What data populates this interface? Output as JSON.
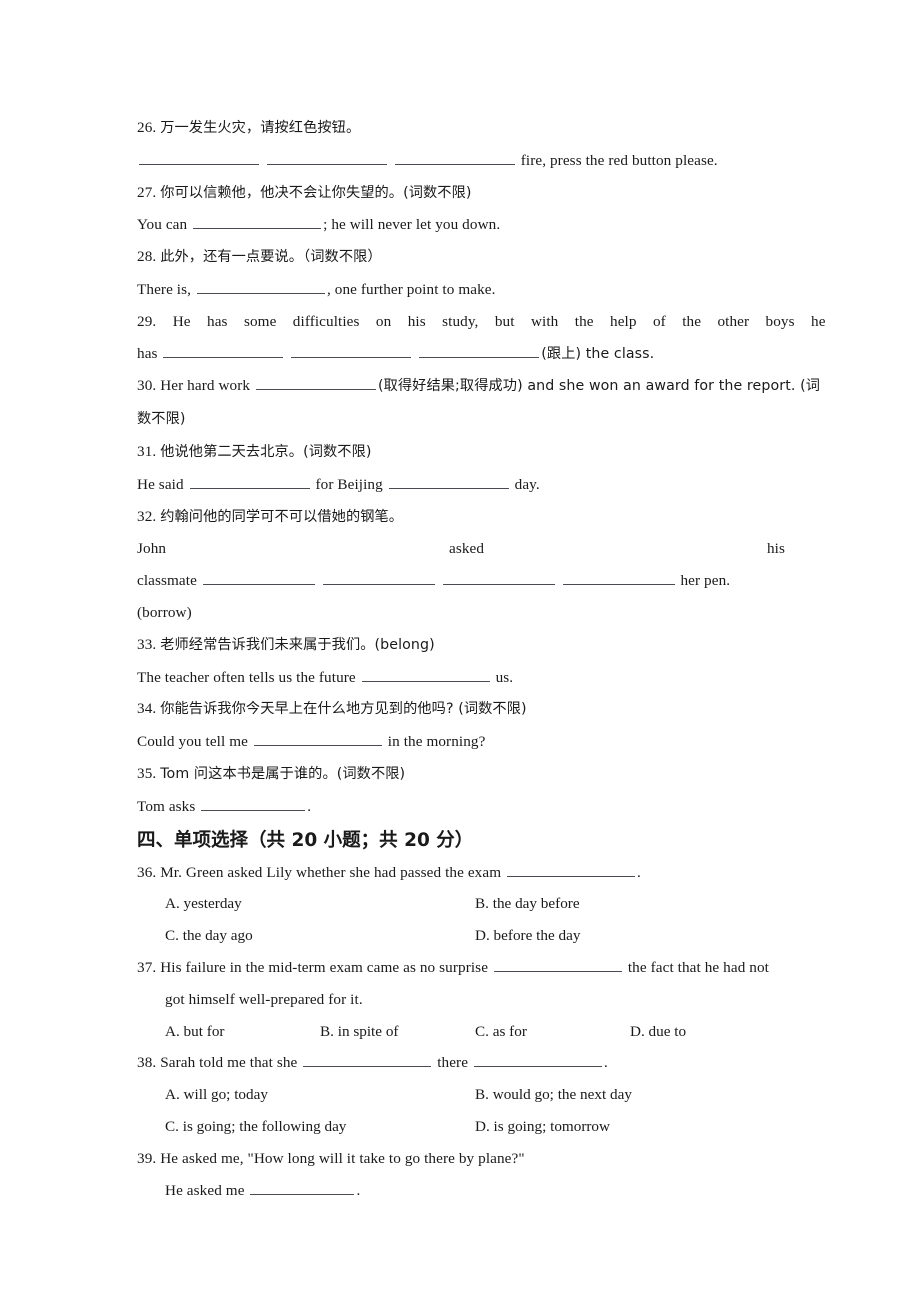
{
  "document": {
    "type": "english-grammar-worksheet",
    "language_mix": "chinese-english"
  },
  "fill_in_blank_items": [
    {
      "number": "26.",
      "prompt_cn": "万一发生火灾，请按红色按钮。",
      "answer_line_tail": "fire, press the red button please.",
      "blanks": 3
    },
    {
      "number": "27.",
      "prompt_cn": "你可以信赖他，他决不会让你失望的。(词数不限)",
      "answer_prefix": "You can",
      "answer_suffix": "; he will never let you down.",
      "blanks": 1
    },
    {
      "number": "28.",
      "prompt_cn": "此外，还有一点要说。（词数不限）",
      "answer_prefix": "There is,",
      "answer_suffix": ", one further point to make.",
      "blanks": 1
    },
    {
      "number": "29.",
      "prompt_en_line1": "He has some difficulties on his study, but with the help of the other boys he",
      "answer_prefix": "has",
      "answer_suffix": "(跟上) the class.",
      "blanks": 3
    },
    {
      "number": "30.",
      "answer_prefix": "Her hard work",
      "answer_suffix": "(取得好结果;取得成功) and she won an award for the report. (词",
      "answer_wrap": "数不限)",
      "blanks": 1
    },
    {
      "number": "31.",
      "prompt_cn": "他说他第二天去北京。(词数不限)",
      "answer_prefix": "He said",
      "answer_mid": "for Beijing",
      "answer_suffix": "day.",
      "blanks": 2
    },
    {
      "number": "32.",
      "prompt_cn": "约翰问他的同学可不可以借她的钢笔。",
      "justified_words": [
        "John",
        "asked",
        "his"
      ],
      "answer_prefix": "classmate",
      "answer_suffix": "her pen.",
      "hint": "(borrow)",
      "blanks": 4
    },
    {
      "number": "33.",
      "prompt_cn": "老师经常告诉我们未来属于我们。(belong)",
      "answer_prefix": "The teacher often tells us the future",
      "answer_suffix": "us.",
      "blanks": 1
    },
    {
      "number": "34.",
      "prompt_cn": "你能告诉我你今天早上在什么地方见到的他吗? (词数不限)",
      "answer_prefix": "Could you tell me",
      "answer_suffix": "in the morning?",
      "blanks": 1
    },
    {
      "number": "35.",
      "prompt_cn": "Tom 问这本书是属于谁的。(词数不限)",
      "answer_prefix": "Tom asks",
      "answer_suffix": ".",
      "blanks": 1
    }
  ],
  "section_heading": {
    "prefix_cn": "四、单项选择（共",
    "count": "20",
    "mid_cn": "小题；共",
    "points": "20",
    "suffix_cn": "分）",
    "full": "四、单项选择（共 20 小题；共 20 分）"
  },
  "multiple_choice_items": [
    {
      "number": "36.",
      "stem_before": "Mr. Green asked Lily whether she had passed the exam",
      "stem_after": ".",
      "layout": "two-column",
      "options": [
        "A. yesterday",
        "B. the day before",
        "C. the day ago",
        "D. before the day"
      ]
    },
    {
      "number": "37.",
      "stem_before": "His failure in the mid-term exam came as no surprise",
      "stem_after": "the fact that he had not",
      "stem_wrap": "got himself well-prepared for it.",
      "layout": "four-column",
      "options": [
        "A. but for",
        "B. in spite of",
        "C. as for",
        "D. due to"
      ]
    },
    {
      "number": "38.",
      "stem_before": "Sarah told me that she",
      "stem_mid": "there",
      "stem_after": ".",
      "layout": "two-column",
      "options": [
        "A. will go; today",
        "B. would go; the next day",
        "C. is going; the following day",
        "D. is going; tomorrow"
      ]
    },
    {
      "number": "39.",
      "stem_quote": "He asked me, \"How long will it take to go there by plane?\"",
      "answer_prefix": "He asked me",
      "answer_suffix": ".",
      "layout": "free-response",
      "blanks": 1
    }
  ],
  "colors": {
    "text": "#1a1a1a",
    "rule": "#4a4a52",
    "background": "#ffffff"
  }
}
